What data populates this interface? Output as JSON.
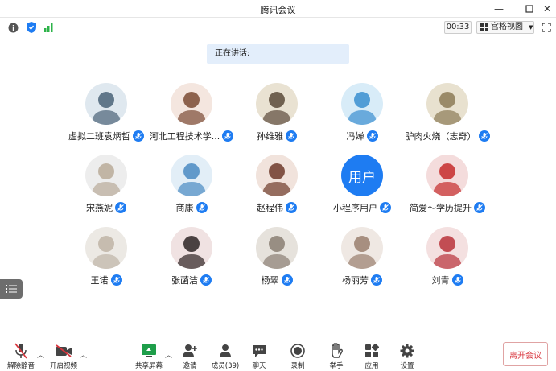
{
  "window": {
    "title": "腾讯会议"
  },
  "toolbar": {
    "timer": "00:33",
    "view_label": "宫格视图"
  },
  "banner": {
    "speaking": "正在讲话:"
  },
  "participants": [
    {
      "name": "虚拟二班袁炳哲",
      "avatar": "photo"
    },
    {
      "name": "河北工程技术学...",
      "avatar": "photo"
    },
    {
      "name": "孙维雅",
      "avatar": "photo"
    },
    {
      "name": "冯婵",
      "avatar": "photo"
    },
    {
      "name": "驴肉火烧（志奇）",
      "avatar": "photo"
    },
    {
      "name": "宋燕妮",
      "avatar": "photo"
    },
    {
      "name": "商康",
      "avatar": "photo"
    },
    {
      "name": "赵程伟",
      "avatar": "photo"
    },
    {
      "name": "小程序用户",
      "avatar_text": "用户"
    },
    {
      "name": "简爱～学历提升",
      "avatar": "photo"
    },
    {
      "name": "王诺",
      "avatar": "photo"
    },
    {
      "name": "张菡洁",
      "avatar": "photo"
    },
    {
      "name": "杨翠",
      "avatar": "photo"
    },
    {
      "name": "杨丽芳",
      "avatar": "photo"
    },
    {
      "name": "刘青",
      "avatar": "photo"
    }
  ],
  "bottombar": {
    "unmute": "解除静音",
    "video": "开启视频",
    "share": "共享屏幕",
    "invite": "邀请",
    "members": "成员(39)",
    "chat": "聊天",
    "record": "录制",
    "raise_hand": "举手",
    "apps": "应用",
    "settings": "设置",
    "leave": "离开会议"
  },
  "colors": {
    "accent": "#1e7cf2",
    "leave": "#d9363e",
    "muted": "#d9363e"
  }
}
